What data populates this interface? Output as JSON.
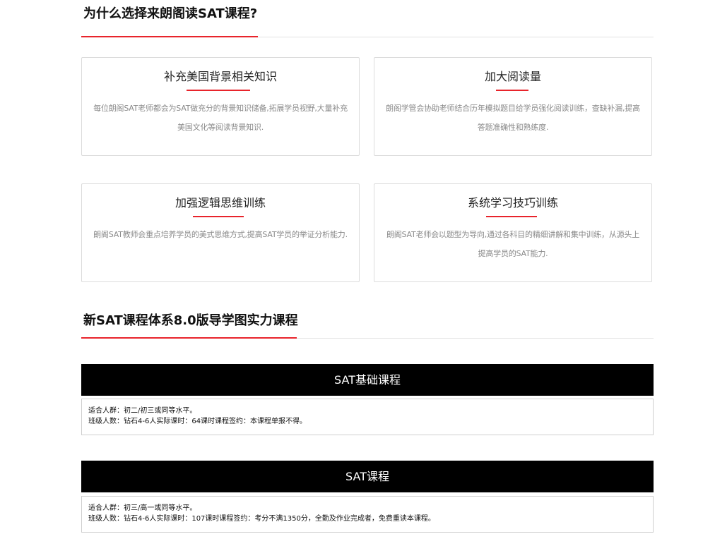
{
  "section1": {
    "title": "为什么选择来朗阁读SAT课程?"
  },
  "features": [
    {
      "title": "补充美国背景相关知识",
      "desc": "每位朗阁SAT老师都会为SAT做充分的背景知识储备,拓展学员视野,大量补充美国文化等阅读背景知识."
    },
    {
      "title": "加大阅读量",
      "desc": "朗阁学管会协助老师结合历年模拟题目给学员强化阅读训练，查缺补漏,提高答题准确性和熟练度."
    },
    {
      "title": "加强逻辑思维训练",
      "desc": "朗阁SAT教师会重点培养学员的美式思维方式,提高SAT学员的举证分析能力."
    },
    {
      "title": "系统学习技巧训练",
      "desc": "朗阁SAT老师会以题型为导向,通过各科目的精细讲解和集中训练，从源头上提高学员的SAT能力."
    }
  ],
  "section2": {
    "title": "新SAT课程体系8.0版导学图实力课程"
  },
  "courses": [
    {
      "name": "SAT基础课程",
      "line1": "适合人群：初二/初三或同等水平。",
      "line2": "班级人数：钻石4-6人实际课时：64课时课程签约：本课程单报不得。"
    },
    {
      "name": "SAT课程",
      "line1": "适合人群：初三/高一或同等水平。",
      "line2": "班级人数：钻石4-6人实际课时：107课时课程签约：考分不满1350分，全勤及作业完成者，免费重读本课程。"
    }
  ],
  "colors": {
    "accent": "#e8242b",
    "course_header_bg": "#000000",
    "desc_text": "#8a8a8a"
  }
}
